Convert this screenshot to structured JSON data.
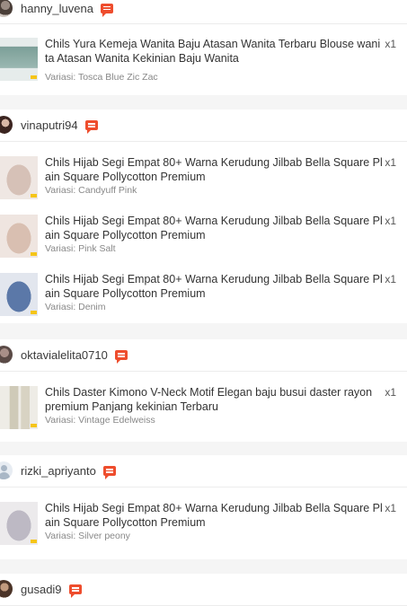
{
  "orders": [
    {
      "buyer": "hanny_luvena",
      "avatar": "avatar-photo",
      "products": [
        {
          "title": "Chils Yura Kemeja Wanita Baju Atasan Wanita Terbaru Blouse wani ta Atasan Wanita Kekinian Baju Wanita",
          "variant": "Variasi: Tosca Blue Zic Zac",
          "qty": "x1",
          "thumb_bg": "#e6eceb",
          "thumb_fg": "#7c9f98"
        }
      ]
    },
    {
      "buyer": "vinaputri94",
      "avatar": "avatar-photo",
      "products": [
        {
          "title": "Chils Hijab Segi Empat 80+ Warna Kerudung Jilbab Bella Square Pl ain Square Pollycotton Premium",
          "variant": "Variasi: Candyuff Pink",
          "qty": "x1",
          "thumb_bg": "#efe7e3",
          "thumb_fg": "#d6c1b7"
        },
        {
          "title": "Chils Hijab Segi Empat 80+ Warna Kerudung Jilbab Bella Square Pl ain Square Pollycotton Premium",
          "variant": "Variasi: Pink Salt",
          "qty": "x1",
          "thumb_bg": "#efe5e0",
          "thumb_fg": "#d9bfb1"
        },
        {
          "title": "Chils Hijab Segi Empat 80+ Warna Kerudung Jilbab Bella Square Pl ain Square Pollycotton Premium",
          "variant": "Variasi: Denim",
          "qty": "x1",
          "thumb_bg": "#e2e6ee",
          "thumb_fg": "#5b78a8"
        }
      ]
    },
    {
      "buyer": "oktavialelita0710",
      "avatar": "avatar-photo",
      "products": [
        {
          "title": "Chils Daster Kimono V-Neck Motif Elegan baju busui daster rayon premium Panjang kekinian Terbaru",
          "variant": "Variasi: Vintage Edelweiss",
          "qty": "x1",
          "thumb_bg": "#eeece6",
          "thumb_fg": "#cfcab8"
        }
      ]
    },
    {
      "buyer": "rizki_apriyanto",
      "avatar": "default-avatar-icon",
      "products": [
        {
          "title": "Chils Hijab Segi Empat 80+ Warna Kerudung Jilbab Bella Square Pl ain Square Pollycotton Premium",
          "variant": "Variasi: Silver peony",
          "qty": "x1",
          "thumb_bg": "#eceaec",
          "thumb_fg": "#bdb9c4"
        }
      ]
    },
    {
      "buyer": "gusadi9",
      "avatar": "avatar-photo",
      "products": []
    }
  ],
  "colors": {
    "accent": "#ee4d2d",
    "background": "#f5f5f5",
    "card": "#ffffff"
  }
}
